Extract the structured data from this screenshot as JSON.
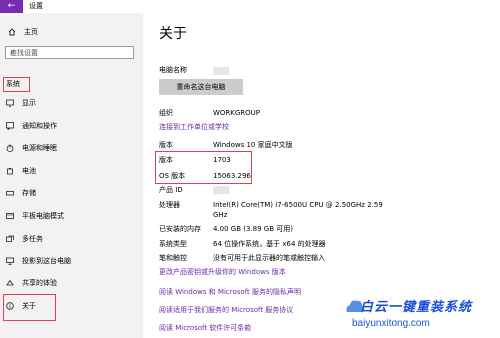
{
  "window": {
    "title": "设置",
    "back_glyph": "←"
  },
  "sidebar": {
    "home_label": "主页",
    "search_placeholder": "查找设置",
    "group_label": "系统",
    "items": [
      {
        "label": "显示",
        "icon": "display-icon"
      },
      {
        "label": "通知和操作",
        "icon": "notification-icon"
      },
      {
        "label": "电源和睡眠",
        "icon": "power-icon"
      },
      {
        "label": "电池",
        "icon": "battery-icon"
      },
      {
        "label": "存储",
        "icon": "storage-icon"
      },
      {
        "label": "平板电脑模式",
        "icon": "tablet-icon"
      },
      {
        "label": "多任务",
        "icon": "multitask-icon"
      },
      {
        "label": "投影到这台电脑",
        "icon": "project-icon"
      },
      {
        "label": "共享的体验",
        "icon": "share-icon"
      },
      {
        "label": "关于",
        "icon": "info-icon"
      }
    ]
  },
  "main": {
    "title": "关于",
    "pc_name_label": "电脑名称",
    "rename_button": "重命名这台电脑",
    "org_label": "组织",
    "org_value": "WORKGROUP",
    "join_link": "连接到工作单位或学校",
    "edition_label": "版本",
    "edition_value": "Windows 10 家庭中文版",
    "version_label": "版本",
    "version_value": "1703",
    "os_build_label": "OS 版本",
    "os_build_value": "15063.296",
    "product_id_label": "产品 ID",
    "processor_label": "处理器",
    "processor_value_1": "Intel(R) Core(TM) i7-6500U CPU @ 2.50GHz   2.59",
    "processor_value_2": "GHz",
    "ram_label": "已安装的内存",
    "ram_value": "4.00 GB (3.89 GB 可用)",
    "system_type_label": "系统类型",
    "system_type_value": "64 位操作系统，基于 x64 的处理器",
    "pen_label": "笔和触控",
    "pen_value": "没有可用于此显示器的笔或触控输入",
    "change_key_link": "更改产品密钥或升级你的 Windows 版本",
    "link_services": "阅读 Windows 和 Microsoft 服务的隐私声明",
    "link_services_agreement": "阅读适用于我们服务的 Microsoft 服务协议",
    "link_license": "阅读 Microsoft 软件许可条款"
  },
  "watermark": {
    "big": "白云一键重装系统",
    "small": "baiyunxitong.com"
  },
  "colors": {
    "accent": "#7a2bb3",
    "link": "#6b2aa6",
    "highlight_box": "#e04050",
    "watermark": "#1a4fd6"
  }
}
